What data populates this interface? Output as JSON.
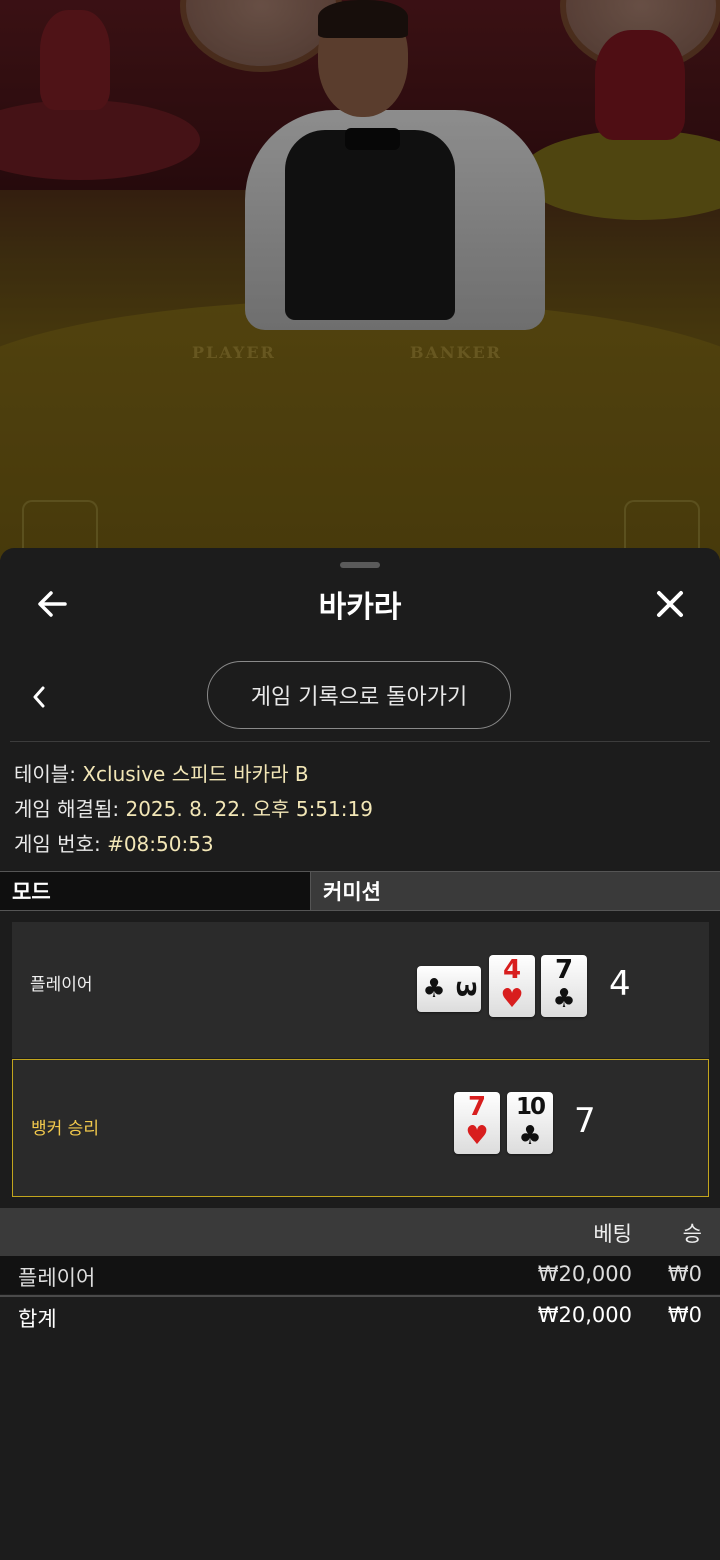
{
  "video": {
    "table_labels": {
      "player": "PLAYER",
      "banker": "BANKER"
    }
  },
  "header": {
    "title": "바카라",
    "back_icon": "arrow-left-icon",
    "close_icon": "close-icon"
  },
  "history": {
    "prev_icon": "chevron-left-icon",
    "back_to_history_label": "게임 기록으로 돌아가기"
  },
  "game_info": {
    "table_label": "테이블:",
    "table_value": "Xclusive 스피드 바카라 B",
    "resolved_label": "게임 해결됨:",
    "resolved_value": "2025. 8. 22. 오후 5:51:19",
    "number_label": "게임 번호:",
    "number_value": "#08:50:53"
  },
  "tabs": {
    "mode": "모드",
    "commission": "커미션"
  },
  "hands": {
    "player": {
      "label": "플레이어",
      "score": "4",
      "cards": [
        {
          "rank": "3",
          "suit": "♣",
          "color": "black",
          "sideways": true
        },
        {
          "rank": "4",
          "suit": "♥",
          "color": "red"
        },
        {
          "rank": "7",
          "suit": "♣",
          "color": "black"
        }
      ]
    },
    "banker": {
      "label": "뱅커 승리",
      "score": "7",
      "cards": [
        {
          "rank": "7",
          "suit": "♥",
          "color": "red"
        },
        {
          "rank": "10",
          "suit": "♣",
          "color": "black"
        }
      ]
    }
  },
  "bets": {
    "headers": {
      "bet": "베팅",
      "win": "승"
    },
    "rows": [
      {
        "name": "플레이어",
        "bet": "₩20,000",
        "win": "₩0"
      }
    ],
    "total": {
      "name": "합계",
      "bet": "₩20,000",
      "win": "₩0"
    }
  },
  "colors": {
    "accent_gold": "#c2a51d",
    "banker_label": "#f2c94c",
    "card_red": "#d81e1e"
  }
}
